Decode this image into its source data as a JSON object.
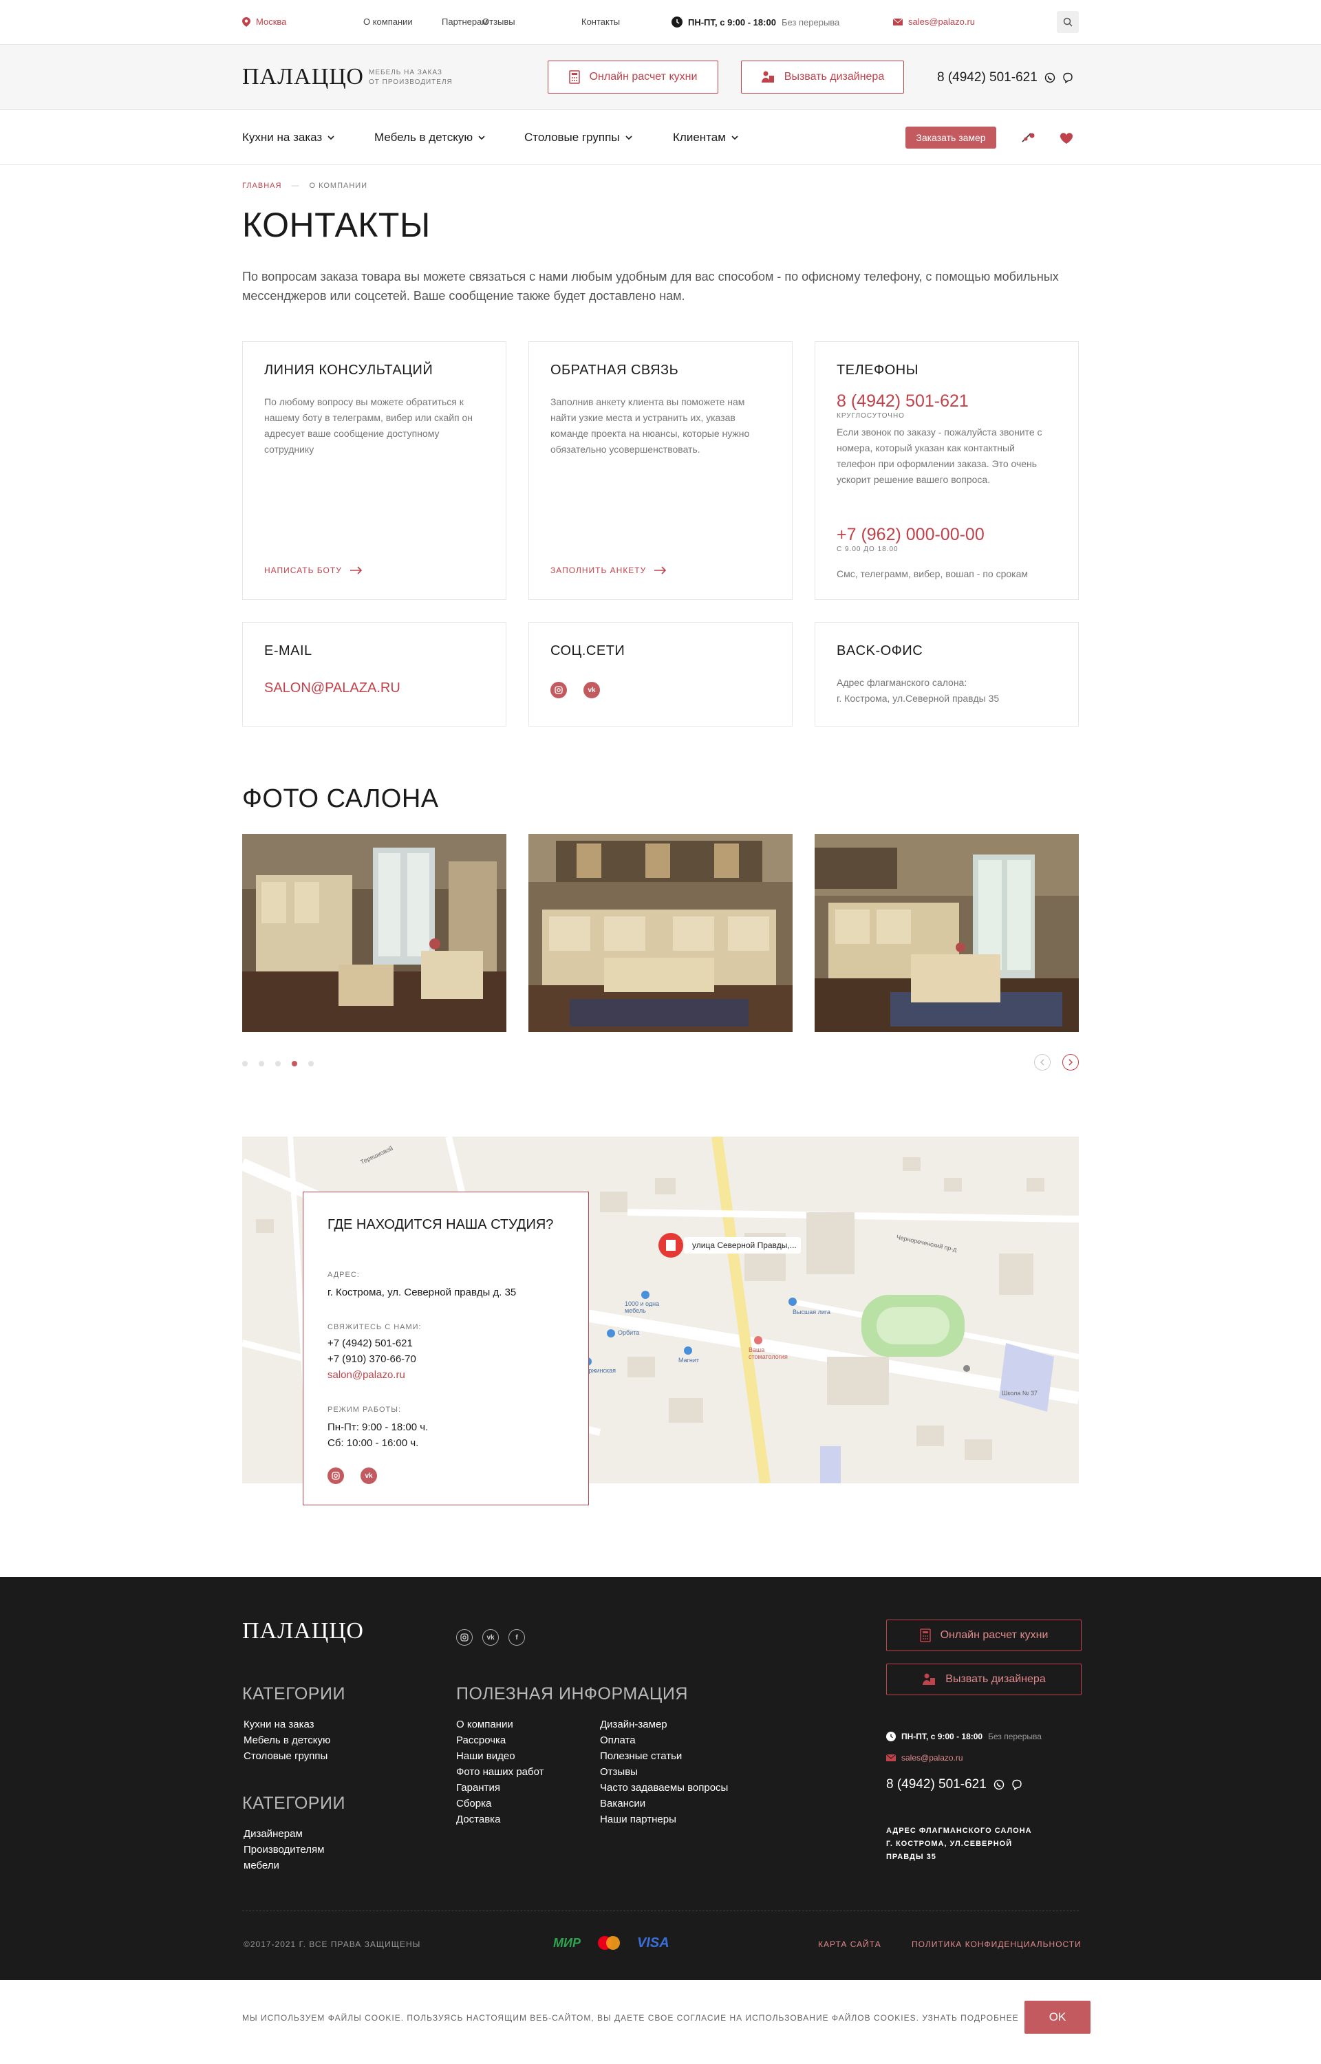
{
  "topbar": {
    "city": "Москва",
    "links": [
      "О компании",
      "Партнерам",
      "Отзывы",
      "Контакты"
    ],
    "hours": "ПН-ПТ, с 9:00 - 18:00",
    "hours_note": "Без перерыва",
    "email": "sales@palazo.ru"
  },
  "header": {
    "logo": "ПАЛАЦЦО",
    "tagline_1": "МЕБЕЛЬ НА ЗАКАЗ",
    "tagline_2": "ОТ ПРОИЗВОДИТЕЛЯ",
    "calc_button": "Онлайн расчет кухни",
    "designer_button": "Вызвать дизайнера",
    "phone": "8 (4942) 501-621"
  },
  "nav": {
    "items": [
      "Кухни на заказ",
      "Мебель в детскую",
      "Столовые группы",
      "Клиентам"
    ],
    "order_button": "Заказать замер"
  },
  "breadcrumbs": [
    "ГЛАВНАЯ",
    "О КОМПАНИИ"
  ],
  "page": {
    "title": "КОНТАКТЫ",
    "lead": "По вопросам заказа товара вы можете связаться с нами любым удобным для вас способом - по офисному телефону, с помощью мобильных мессенджеров или соцсетей. Ваше сообщение также будет доставлено нам."
  },
  "cards": {
    "consult": {
      "title": "ЛИНИЯ КОНСУЛЬТАЦИЙ",
      "text": "По любому вопросу вы можете обратиться к нашему боту в телеграмм, вибер или скайп он адресует ваше сообщение доступному сотруднику",
      "action": "НАПИСАТЬ БОТУ"
    },
    "feedback": {
      "title": "ОБРАТНАЯ СВЯЗЬ",
      "text": "Заполнив анкету клиента вы поможете нам найти узкие места и устранить их, указав команде проекта на нюансы, которые нужно обязательно усовершенствовать.",
      "action": "ЗАПОЛНИТЬ АНКЕТУ"
    },
    "phones": {
      "title": "ТЕЛЕФОНЫ",
      "phone1": "8 (4942) 501-621",
      "phone1_note": "КРУГЛОСУТОЧНО",
      "text": "Если звонок по заказу - пожалуйста звоните с номера, который указан как контактный телефон при оформлении заказа. Это очень ускорит решение вашего вопроса.",
      "phone2": "+7 (962) 000-00-00",
      "phone2_note": "С 9.00 ДО 18.00",
      "phone2_text": "Смс, телеграмм, вибер, вошап - по срокам"
    },
    "email": {
      "title": "E-MAIL",
      "value": "SALON@PALAZA.RU"
    },
    "social": {
      "title": "СОЦ.СЕТИ"
    },
    "office": {
      "title": "BACK-ОФИС",
      "text1": "Адрес флагманского салона:",
      "text2": "г. Кострома, ул.Северной правды 35"
    }
  },
  "photos": {
    "title": "ФОТО САЛОНА",
    "slide_count": 5,
    "active_slide": 4
  },
  "map": {
    "title": "ГДЕ НАХОДИТСЯ НАША СТУДИЯ?",
    "address_label": "АДРЕС:",
    "address": "г. Кострома, ул. Северной правды д. 35",
    "contact_label": "СВЯЖИТЕСЬ С НАМИ:",
    "phone1": "+7 (4942) 501-621",
    "phone2": "+7 (910) 370-66-70",
    "email": "salon@palazo.ru",
    "hours_label": "РЕЖИМ РАБОТЫ:",
    "hours1": "Пн-Пт: 9:00 - 18:00 ч.",
    "hours2": "Сб: 10:00 - 16:00 ч.",
    "pin_label": "улица Северной Правды,...",
    "places": [
      "1000 и одна мебель",
      "Орбита",
      "Дзержинская",
      "Магнит",
      "Высшая лига",
      "Ваша стоматология",
      "Школа № 37",
      "Чернореченский пр-д",
      "Терешковой"
    ]
  },
  "footer": {
    "logo": "ПАЛАЦЦО",
    "cat_title": "КАТЕГОРИИ",
    "cat_links": [
      "Кухни на заказ",
      "Мебель в детскую",
      "Столовые группы"
    ],
    "cat2_title": "КАТЕГОРИИ",
    "cat2_links": [
      "Дизайнерам",
      "Производителям",
      "мебели"
    ],
    "info_title": "ПОЛЕЗНАЯ ИНФОРМАЦИЯ",
    "info_col1": [
      "О компании",
      "Рассрочка",
      "Наши видео",
      "Фото наших работ",
      "Гарантия",
      "Сборка",
      "Доставка"
    ],
    "info_col2": [
      "Дизайн-замер",
      "Оплата",
      "Полезные статьи",
      "Отзывы",
      "Часто задаваемы вопросы",
      "Вакансии",
      "Наши партнеры"
    ],
    "calc_button": "Онлайн расчет кухни",
    "designer_button": "Вызвать дизайнера",
    "hours": "ПН-ПТ, с 9:00 - 18:00",
    "hours_note": "Без перерыва",
    "email": "sales@palazo.ru",
    "phone": "8 (4942) 501-621",
    "address_1": "АДРЕС ФЛАГМАНСКОГО САЛОНА",
    "address_2": "Г. КОСТРОМА, УЛ.СЕВЕРНОЙ",
    "address_3": "ПРАВДЫ 35",
    "copyright": "©2017-2021 Г. ВСЕ ПРАВА ЗАЩИЩЕНЫ",
    "pay_mir": "МИР",
    "pay_visa": "VISA",
    "sitemap": "КАРТА САЙТА",
    "privacy": "ПОЛИТИКА КОНФИДЕНЦИАЛЬНОСТИ"
  },
  "cookie": {
    "text": "МЫ ИСПОЛЬЗУЕМ ФАЙЛЫ COOKIE. ПОЛЬЗУЯСЬ НАСТОЯЩИМ ВЕБ-САЙТОМ, ВЫ ДАЕТЕ СВОЕ СОГЛАСИЕ НА ИСПОЛЬЗОВАНИЕ ФАЙЛОВ COOKIES. УЗНАТЬ ПОДРОБНЕЕ",
    "ok": "OK"
  },
  "colors": {
    "accent": "#c0424a",
    "button": "#c25a5f",
    "footer_bg": "#1b1b1b"
  }
}
